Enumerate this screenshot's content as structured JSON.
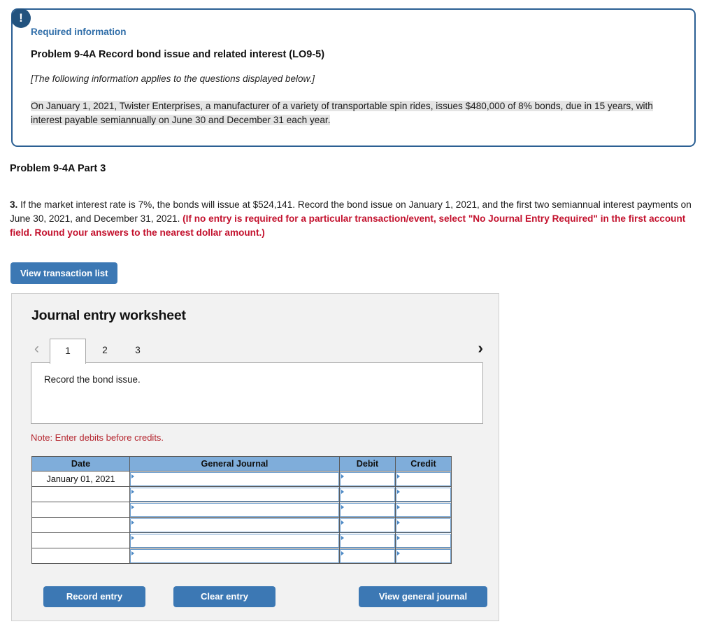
{
  "alert": {
    "icon": "exclamation-icon",
    "required_label": "Required information",
    "problem_title": "Problem 9-4A Record bond issue and related interest (LO9-5)",
    "applies_note": "[The following information applies to the questions displayed below.]",
    "scenario": "On January 1, 2021, Twister Enterprises, a manufacturer of a variety of transportable spin rides, issues $480,000 of 8% bonds, due in 15 years, with interest payable semiannually on June 30 and December 31 each year.",
    "border_color": "#2b5f93",
    "highlight_color": "#e4e4e4"
  },
  "part": {
    "heading": "Problem 9-4A Part 3",
    "question_number": "3.",
    "question_text": " If the market interest rate is 7%, the bonds will issue at $524,141. Record the bond issue on January 1, 2021, and the first two semiannual interest payments on June 30, 2021, and December 31, 2021. ",
    "question_bold_red": "(If no entry is required for a particular transaction/event, select \"No Journal Entry Required\" in the first account field. Round your answers to the nearest dollar amount.)",
    "red_color": "#c3112d"
  },
  "toolbar": {
    "view_transaction_list": "View transaction list",
    "button_color": "#3c78b4"
  },
  "worksheet": {
    "title": "Journal entry worksheet",
    "prev_arrow": "‹",
    "next_arrow": "›",
    "tabs": [
      {
        "label": "1",
        "active": true
      },
      {
        "label": "2",
        "active": false
      },
      {
        "label": "3",
        "active": false
      }
    ],
    "panel_text": "Record the bond issue.",
    "note": "Note: Enter debits before credits.",
    "note_color": "#b5262f",
    "table": {
      "headers": [
        "Date",
        "General Journal",
        "Debit",
        "Credit"
      ],
      "header_color": "#7fadda",
      "rows": [
        {
          "date": "January 01, 2021",
          "general_journal": "",
          "debit": "",
          "credit": ""
        },
        {
          "date": "",
          "general_journal": "",
          "debit": "",
          "credit": ""
        },
        {
          "date": "",
          "general_journal": "",
          "debit": "",
          "credit": ""
        },
        {
          "date": "",
          "general_journal": "",
          "debit": "",
          "credit": ""
        },
        {
          "date": "",
          "general_journal": "",
          "debit": "",
          "credit": ""
        },
        {
          "date": "",
          "general_journal": "",
          "debit": "",
          "credit": ""
        }
      ]
    },
    "buttons": {
      "record_entry": "Record entry",
      "clear_entry": "Clear entry",
      "view_general_journal": "View general journal"
    }
  }
}
